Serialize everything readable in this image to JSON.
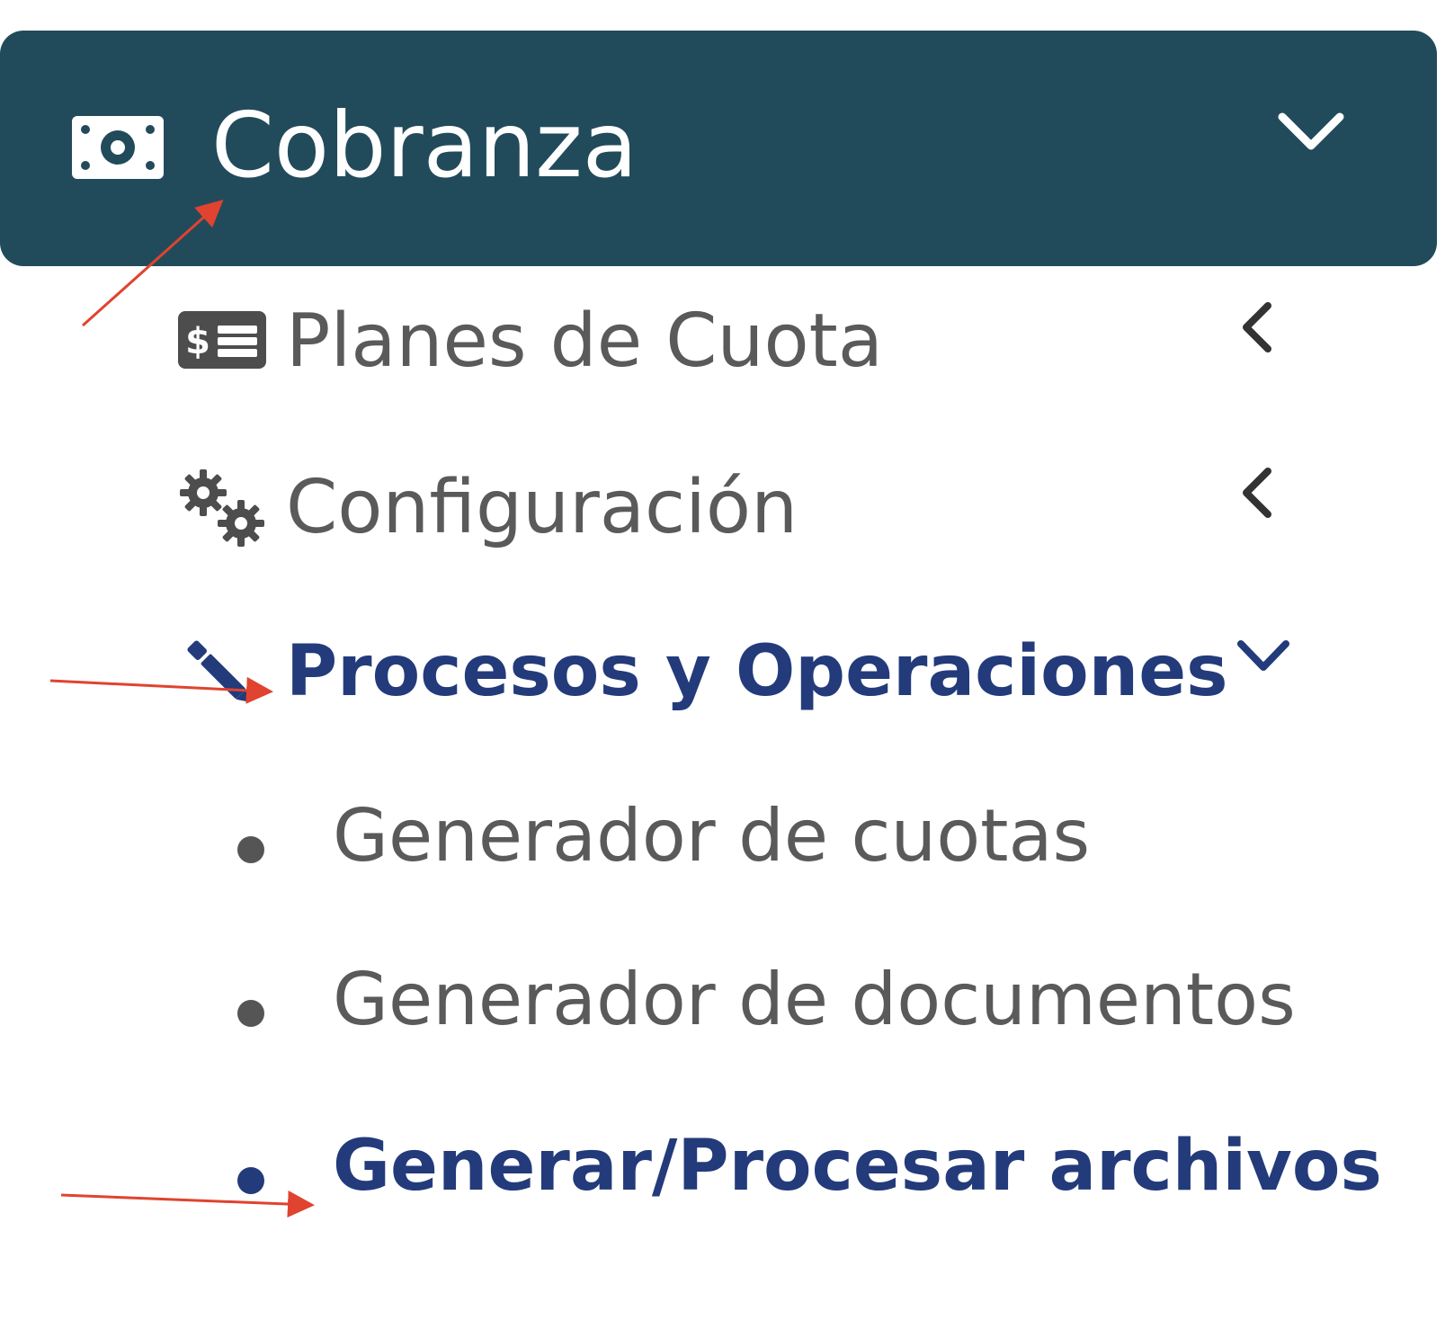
{
  "header": {
    "label": "Cobranza",
    "icon": "money-bill-icon",
    "chevron_icon": "chevron-down-icon",
    "bg_color": "#214b5a",
    "expanded": true
  },
  "items": [
    {
      "label": "Planes de Cuota",
      "icon": "money-check-icon",
      "chevron_icon": "chevron-left-icon",
      "expanded": false
    },
    {
      "label": "Configuración",
      "icon": "gears-icon",
      "chevron_icon": "chevron-left-icon",
      "expanded": false
    },
    {
      "label": "Procesos y Operaciones",
      "icon": "pen-icon",
      "chevron_icon": "chevron-down-icon",
      "expanded": true,
      "active": true,
      "children": [
        {
          "label": "Generador de cuotas"
        },
        {
          "label": "Generador de documentos"
        },
        {
          "label": "Generar/Procesar archivos",
          "active": true
        }
      ]
    }
  ],
  "colors": {
    "active_text": "#233b7b",
    "muted_text": "#5a5a5a",
    "annotation_arrow": "#e0432f"
  }
}
